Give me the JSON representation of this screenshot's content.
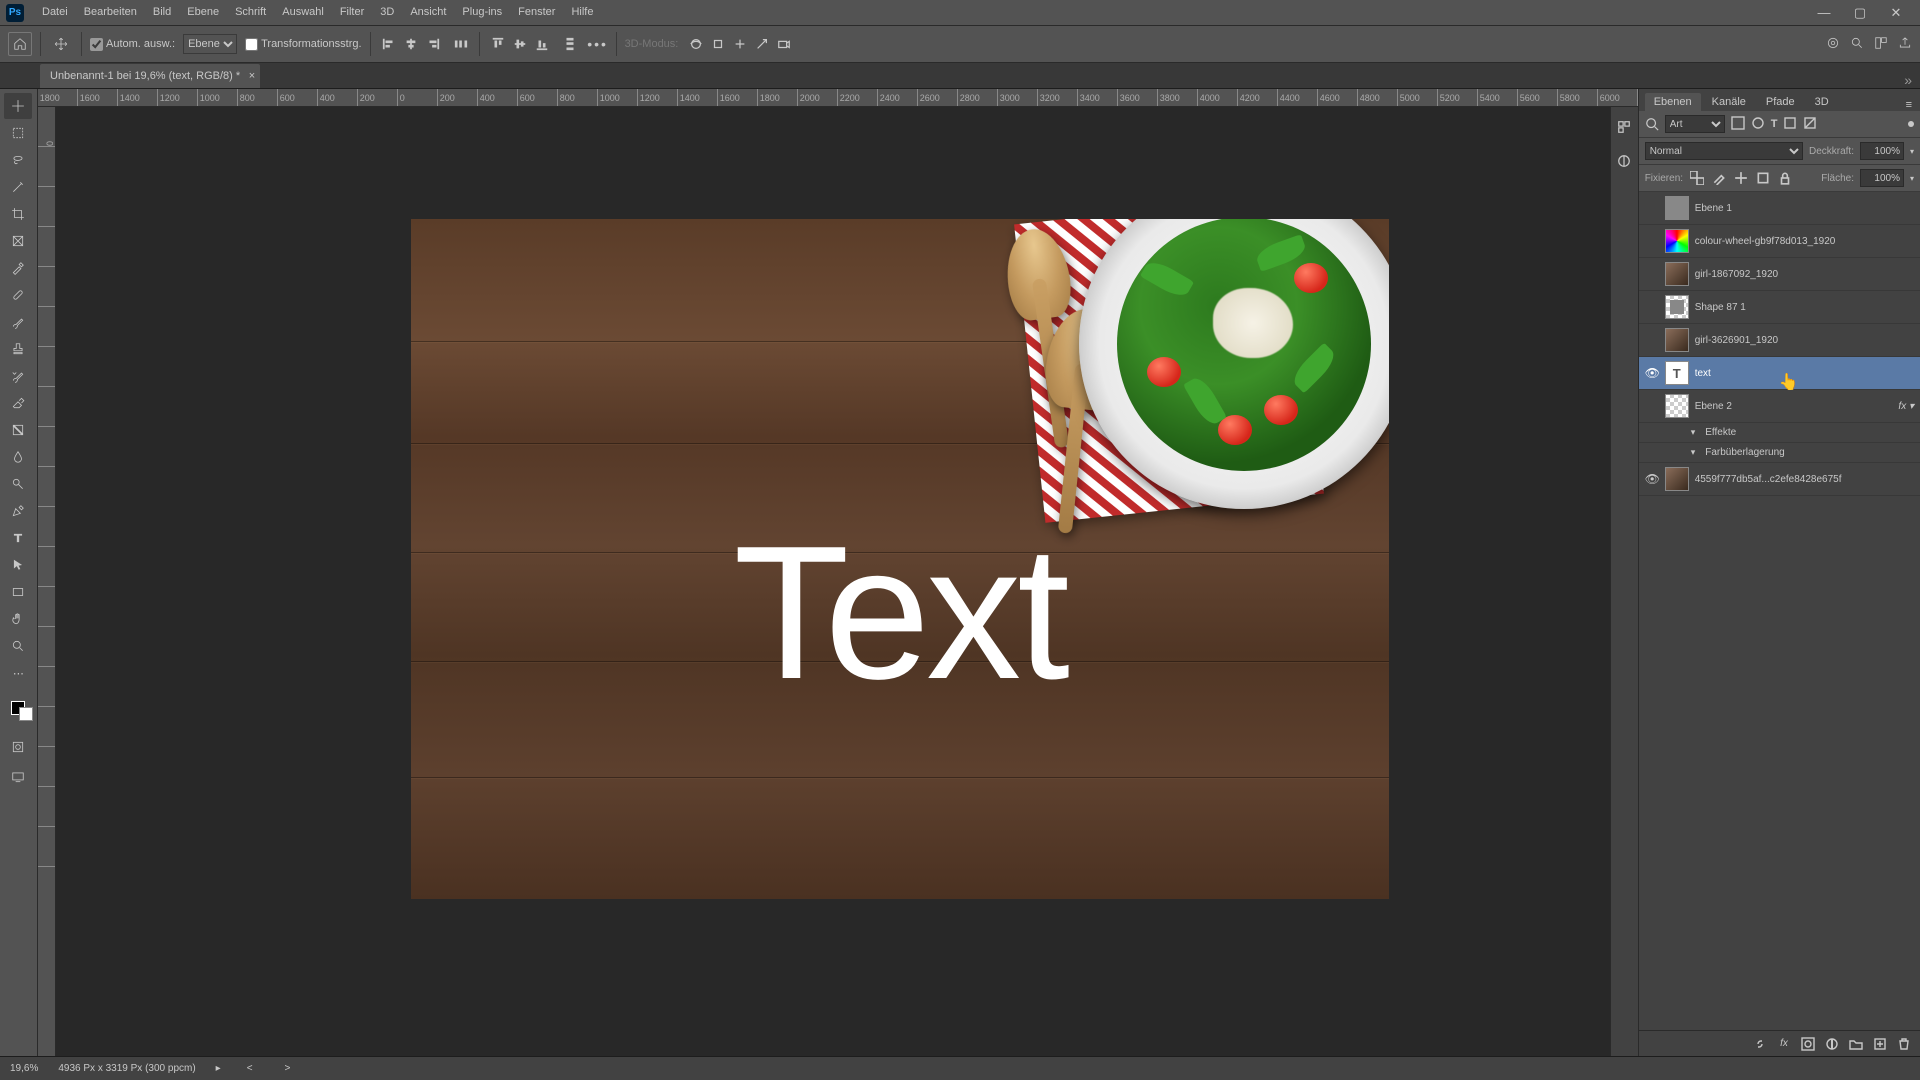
{
  "app": {
    "logo": "Ps"
  },
  "menu": [
    "Datei",
    "Bearbeiten",
    "Bild",
    "Ebene",
    "Schrift",
    "Auswahl",
    "Filter",
    "3D",
    "Ansicht",
    "Plug-ins",
    "Fenster",
    "Hilfe"
  ],
  "options": {
    "auto_select_label": "Autom. ausw.:",
    "auto_select_target": "Ebene",
    "transform_controls_label": "Transformationsstrg.",
    "threed_mode_label": "3D-Modus:"
  },
  "doc_tab": "Unbenannt-1 bei 19,6% (text, RGB/8) *",
  "ruler_h": [
    "1800",
    "1600",
    "1400",
    "1200",
    "1000",
    "800",
    "600",
    "400",
    "200",
    "0",
    "200",
    "400",
    "600",
    "800",
    "1000",
    "1200",
    "1400",
    "1600",
    "1800",
    "2000",
    "2200",
    "2400",
    "2600",
    "2800",
    "3000",
    "3200",
    "3400",
    "3600",
    "3800",
    "4000",
    "4200",
    "4400",
    "4600",
    "4800",
    "5000",
    "5200",
    "5400",
    "5600",
    "5800",
    "6000"
  ],
  "ruler_v": [
    "0",
    "",
    "",
    "",
    "",
    "",
    "",
    "",
    "",
    "",
    "",
    "",
    "",
    "",
    "",
    "",
    "",
    "",
    ""
  ],
  "canvas_text": "Text",
  "panels": {
    "tabs": [
      "Ebenen",
      "Kanäle",
      "Pfade",
      "3D"
    ],
    "active_tab_index": 0,
    "filter_label": "Art",
    "blend_mode": "Normal",
    "opacity_label": "Deckkraft:",
    "opacity_value": "100%",
    "lock_label": "Fixieren:",
    "fill_label": "Fläche:",
    "fill_value": "100%"
  },
  "layers": [
    {
      "visible": false,
      "thumb": "solid",
      "name": "Ebene 1"
    },
    {
      "visible": false,
      "thumb": "wheel",
      "name": "colour-wheel-gb9f78d013_1920"
    },
    {
      "visible": false,
      "thumb": "photo",
      "name": "girl-1867092_1920"
    },
    {
      "visible": false,
      "thumb": "shape",
      "name": "Shape 87 1"
    },
    {
      "visible": false,
      "thumb": "photo",
      "name": "girl-3626901_1920"
    },
    {
      "visible": true,
      "thumb": "T",
      "name": "text",
      "selected": true
    },
    {
      "visible": false,
      "thumb": "checker",
      "name": "Ebene 2",
      "fx": true
    },
    {
      "sub": true,
      "visible": false,
      "name": "Effekte"
    },
    {
      "sub": true,
      "visible": false,
      "name": "Farbüberlagerung"
    },
    {
      "visible": true,
      "thumb": "photo",
      "name": "4559f777db5af...c2efe8428e675f"
    }
  ],
  "status": {
    "zoom": "19,6%",
    "dims": "4936 Px x 3319 Px (300 ppcm)"
  }
}
